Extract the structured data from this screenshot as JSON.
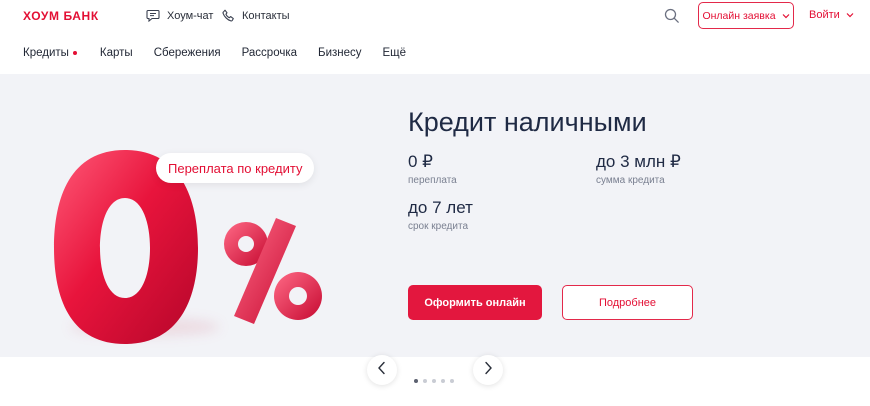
{
  "header": {
    "logo": "ХОУМ БАНК",
    "chat_label": "Хоум-чат",
    "contacts_label": "Контакты",
    "apply_label": "Онлайн заявка",
    "login_label": "Войти"
  },
  "nav": {
    "items": [
      {
        "label": "Кредиты",
        "active": true
      },
      {
        "label": "Карты"
      },
      {
        "label": "Сбережения"
      },
      {
        "label": "Рассрочка"
      },
      {
        "label": "Бизнесу"
      },
      {
        "label": "Ещё"
      }
    ]
  },
  "hero": {
    "bubble_text": "Переплата по кредиту",
    "title": "Кредит наличными",
    "stats": [
      {
        "value": "0 ₽",
        "label": "переплата"
      },
      {
        "value": "до 3 млн ₽",
        "label": "сумма кредита"
      },
      {
        "value": "до 7 лет",
        "label": "срок кредита"
      }
    ],
    "primary_button": "Оформить онлайн",
    "secondary_button": "Подробнее"
  },
  "carousel": {
    "slide_count": 5,
    "active_index": 0
  },
  "icons": {
    "chat": "chat-icon",
    "contacts": "phone-icon",
    "search": "search-icon",
    "dropdown": "chevron-down-icon",
    "prev": "chevron-left-icon",
    "next": "chevron-right-icon"
  },
  "colors": {
    "brand": "#e30f34",
    "hero_background": "#f2f3f7",
    "heading": "#1f2a44"
  }
}
